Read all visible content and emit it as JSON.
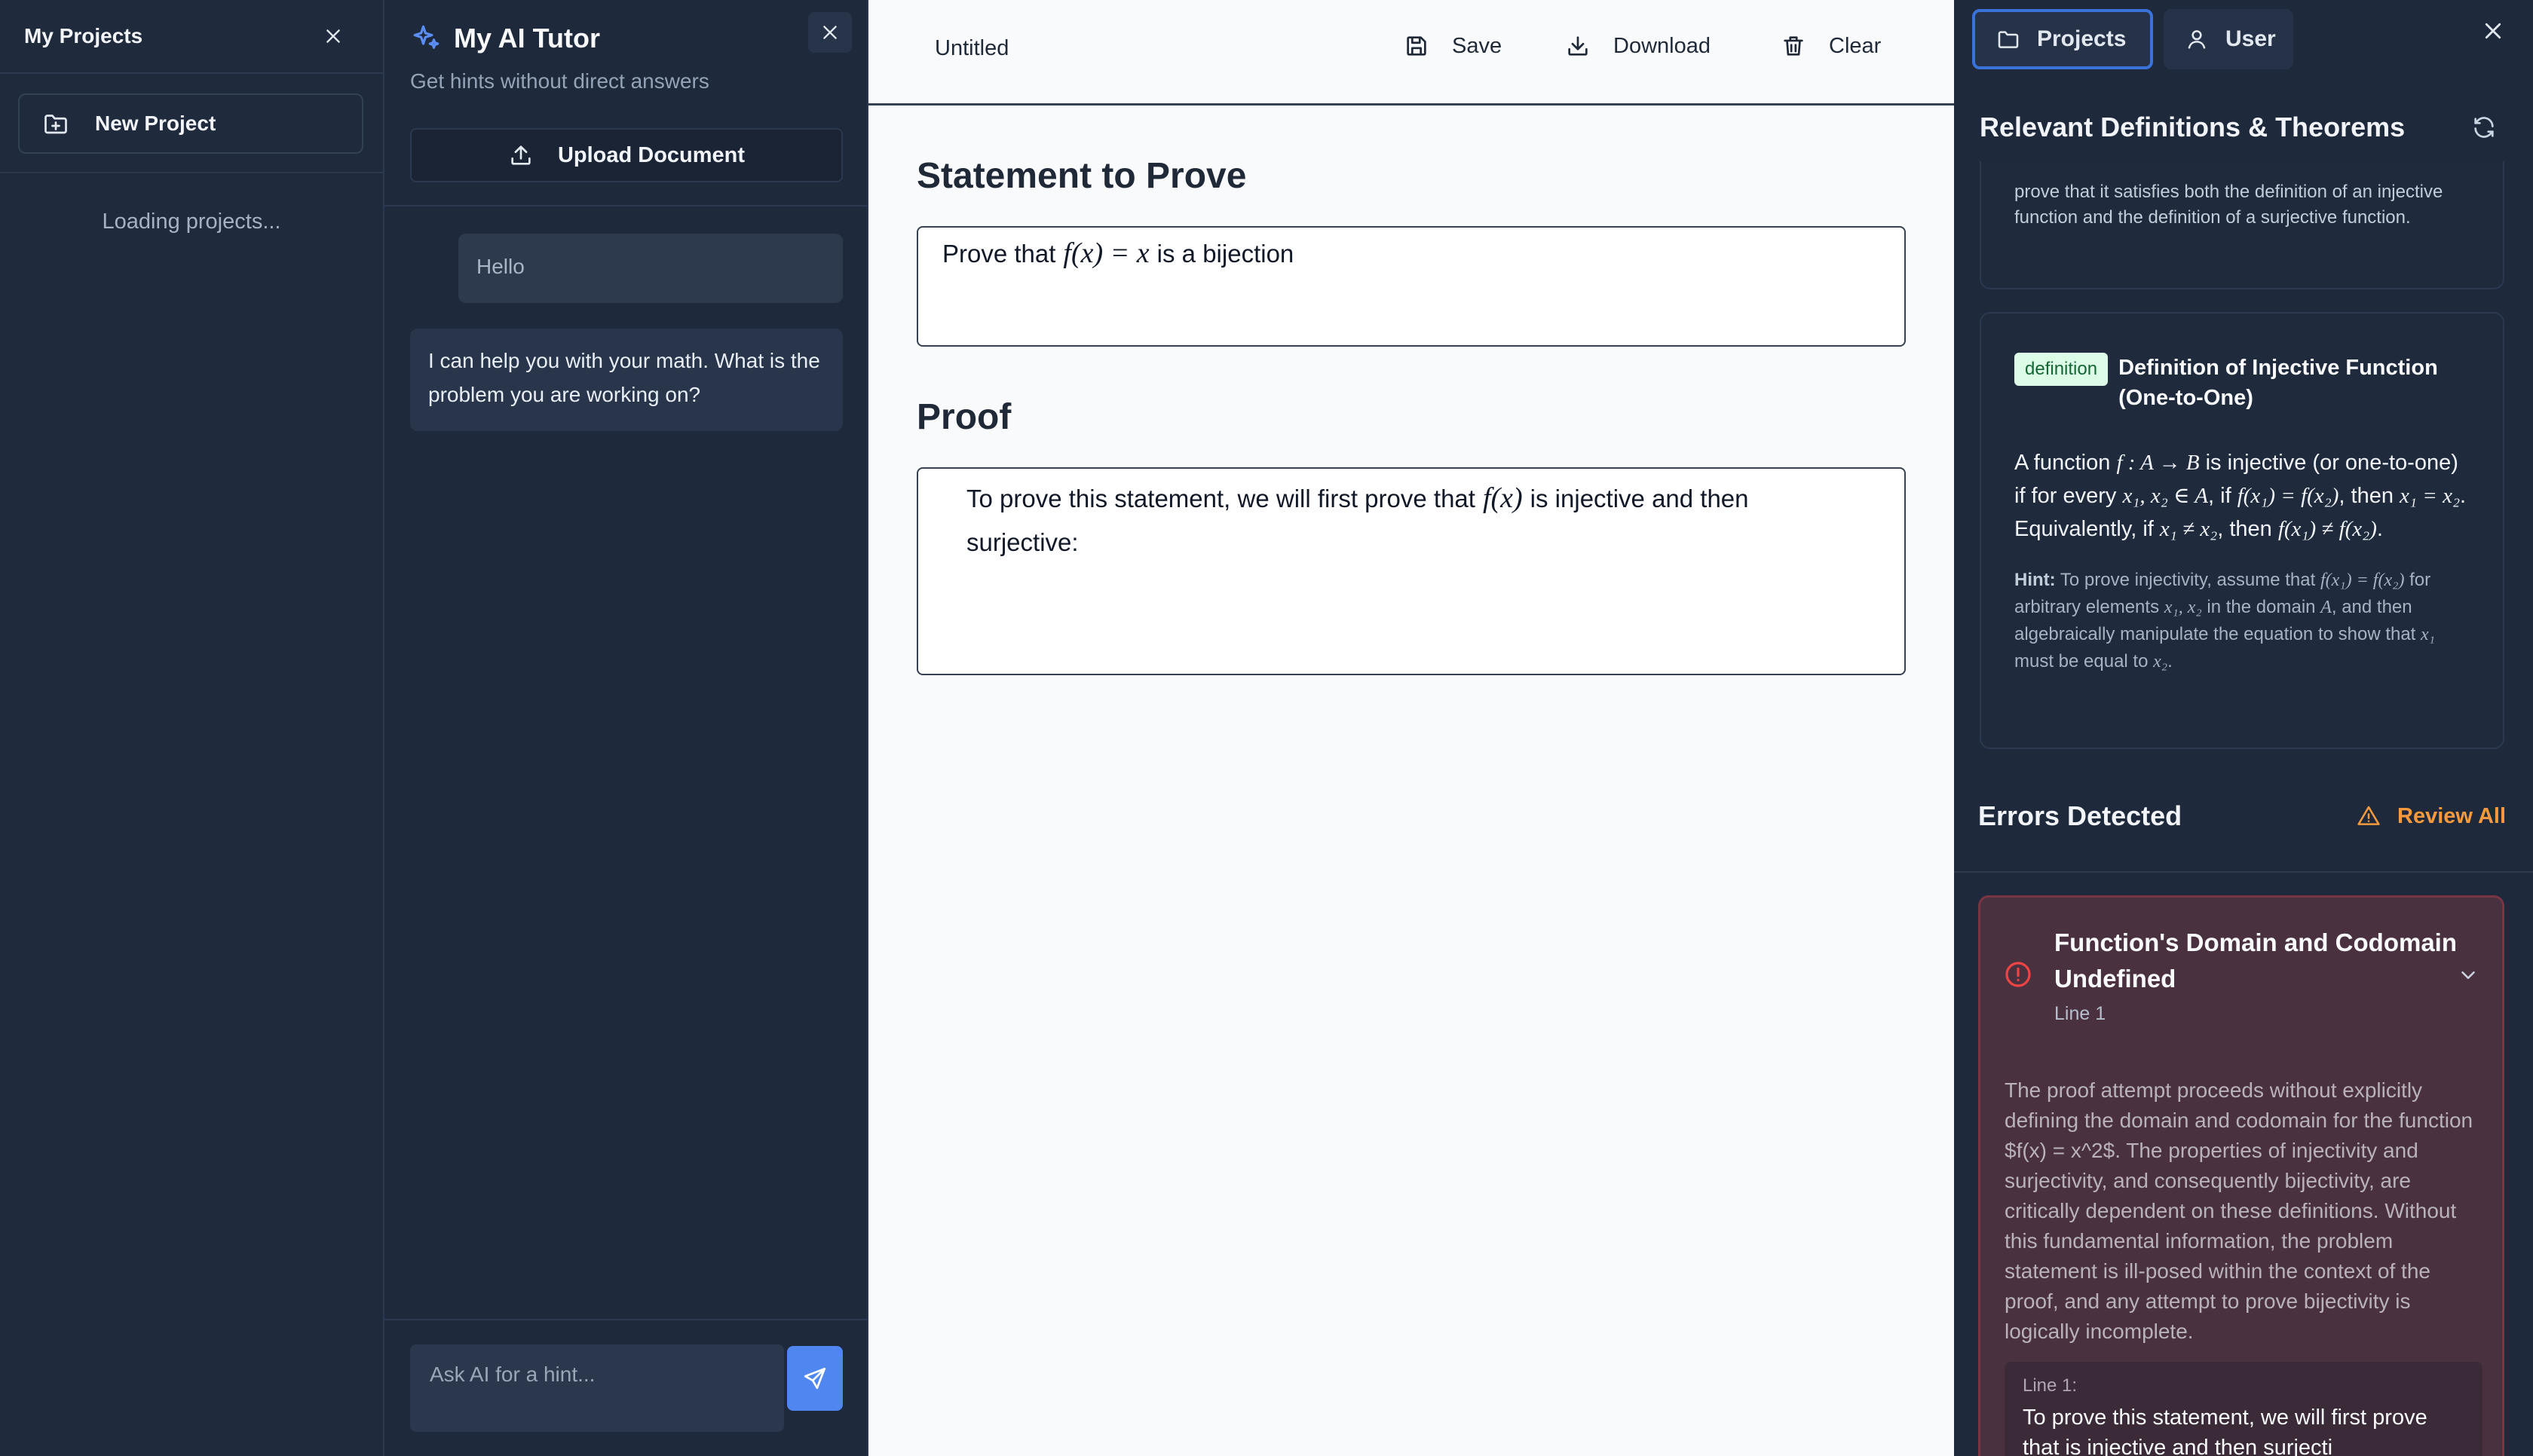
{
  "projects": {
    "title": "My Projects",
    "new_project_label": "New Project",
    "loading_text": "Loading projects..."
  },
  "tutor": {
    "title": "My AI Tutor",
    "subtitle": "Get hints without direct answers",
    "upload_label": "Upload Document",
    "messages": [
      {
        "role": "user",
        "text": "Hello"
      },
      {
        "role": "assistant",
        "text": "I can help you with your math. What is the problem you are working on?"
      }
    ],
    "input_placeholder": "Ask AI for a hint..."
  },
  "editor": {
    "doc_name": "Untitled",
    "save_label": "Save",
    "download_label": "Download",
    "clear_label": "Clear",
    "statement_heading": "Statement to Prove",
    "statement_prefix": "Prove that",
    "statement_math": "f(x) = x",
    "statement_suffix": "is a bijection",
    "proof_heading": "Proof",
    "proof_prefix": "To prove this statement, we will first prove that",
    "proof_math": "f(x)",
    "proof_suffix_1": "is injective and then",
    "proof_suffix_2": "surjective:"
  },
  "right": {
    "tab_projects": "Projects",
    "tab_user": "User",
    "defs_heading": "Relevant Definitions & Theorems",
    "top_card_text": "prove that it satisfies both the definition of an injective function and the definition of a surjective function.",
    "def_badge": "definition",
    "def_title": "Definition of Injective Function (One-to-One)",
    "def_body": {
      "p1": "A function ",
      "m1": "f : A → B",
      "p2": " is injective (or one-to-one) if for every ",
      "m2": "x₁, x₂ ∈ A",
      "p3": ", if ",
      "m3": "f(x₁) = f(x₂)",
      "p4": ", then ",
      "m4": "x₁ = x₂",
      "p5": ". Equivalently, if ",
      "m5": "x₁ ≠ x₂",
      "p6": ", then ",
      "m6": "f(x₁) ≠ f(x₂)",
      "p7": "."
    },
    "hint": {
      "label": "Hint:",
      "p1": " To prove injectivity, assume that ",
      "m1": "f(x₁) = f(x₂)",
      "p2": " for arbitrary elements ",
      "m2": "x₁, x₂",
      "p3": " in the domain ",
      "m3": "A",
      "p4": ", and then algebraically manipulate the equation to show that ",
      "m4": "x₁",
      "p5": " must be equal to ",
      "m5": "x₂",
      "p6": "."
    },
    "errors_heading": "Errors Detected",
    "review_all_label": "Review All",
    "error": {
      "title": "Function's Domain and Codomain Undefined",
      "line": "Line 1",
      "body": "The proof attempt proceeds without explicitly defining the domain and codomain for the function $f(x) = x^2$. The properties of injectivity and surjectivity, and consequently bijectivity, are critically dependent on these definitions. Without this fundamental information, the problem statement is ill-posed within the context of the proof, and any attempt to prove bijectivity is logically incomplete.",
      "snippet_label": "Line 1:",
      "snippet_text": "To prove this statement, we will first prove that is injective and then surjecti"
    }
  },
  "colors": {
    "accent": "#4f86f0",
    "warning": "#f59a3c",
    "error_bg": "#4a3140",
    "badge_bg": "#dcfce7"
  }
}
